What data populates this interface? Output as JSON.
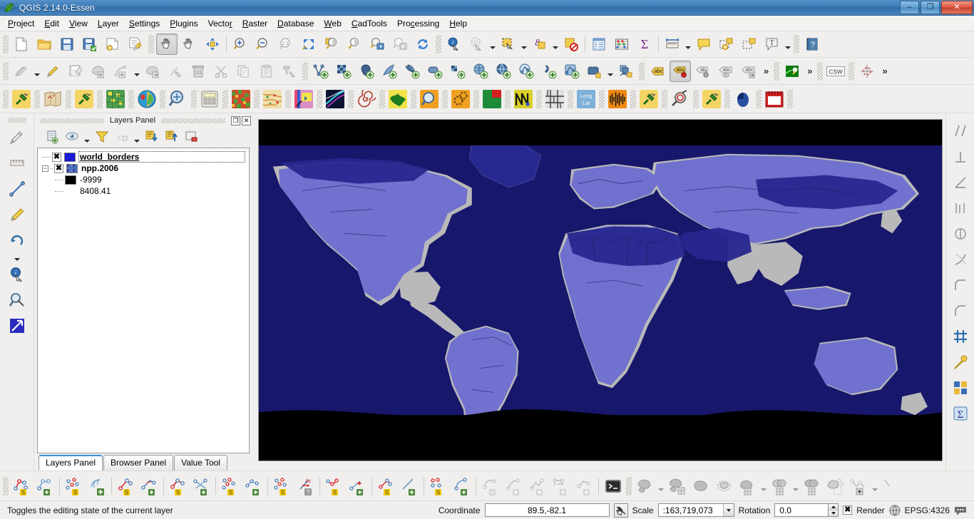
{
  "window": {
    "title": "QGIS 2.14.0-Essen",
    "app_icon": "qgis-logo-icon",
    "minimize_label": "–",
    "maximize_label": "❐",
    "close_label": "✕"
  },
  "menubar": {
    "items": [
      {
        "label": "Project",
        "accel": "P"
      },
      {
        "label": "Edit",
        "accel": "E"
      },
      {
        "label": "View",
        "accel": "V"
      },
      {
        "label": "Layer",
        "accel": "L"
      },
      {
        "label": "Settings",
        "accel": "S"
      },
      {
        "label": "Plugins",
        "accel": "P"
      },
      {
        "label": "Vector",
        "accel": "r"
      },
      {
        "label": "Raster",
        "accel": "R"
      },
      {
        "label": "Database",
        "accel": "D"
      },
      {
        "label": "Web",
        "accel": "W"
      },
      {
        "label": "CadTools",
        "accel": "C"
      },
      {
        "label": "Processing",
        "accel": "c"
      },
      {
        "label": "Help",
        "accel": "H"
      }
    ]
  },
  "toolbar_row1": {
    "icons": [
      "new-project-icon",
      "open-project-icon",
      "save-project-icon",
      "save-project-as-icon",
      "new-print-composer-icon",
      "composer-manager-icon",
      "pan-map-icon",
      "pan-to-selection-icon",
      "zoom-full-extent-icon",
      "zoom-in-icon",
      "zoom-out-icon",
      "zoom-native-icon",
      "zoom-full-icon",
      "zoom-to-layer-icon",
      "zoom-to-selection-icon",
      "zoom-last-icon",
      "zoom-next-icon",
      "refresh-icon",
      "identify-features-icon",
      "run-feature-action-icon",
      "select-features-icon",
      "select-by-expression-icon",
      "deselect-features-icon",
      "open-attribute-table-icon",
      "field-calculator-icon",
      "statistical-summary-icon",
      "measure-line-icon",
      "map-tips-icon",
      "new-map-note-icon",
      "annotation-icon",
      "text-annotation-icon",
      "help-icon"
    ],
    "active_tool": "pan-map-icon"
  },
  "toolbar_row2": {
    "icons": [
      "current-edits-icon",
      "toggle-editing-icon",
      "save-layer-edits-icon",
      "add-feature-icon",
      "add-node-icon",
      "move-feature-icon",
      "node-tool-icon",
      "delete-selected-icon",
      "cut-features-icon",
      "copy-features-icon",
      "paste-features-icon",
      "advanced-digitizing-icon",
      "add-vector-layer-icon",
      "add-raster-layer-icon",
      "add-postgis-layer-icon",
      "add-spatialite-layer-icon",
      "add-mssql-layer-icon",
      "add-oracle-layer-icon",
      "add-db2-layer-icon",
      "add-wms-layer-icon",
      "add-wcs-layer-icon",
      "add-wfs-layer-icon",
      "add-delimited-text-layer-icon",
      "new-shapefile-icon",
      "gps-tools-icon",
      "offline-editing-icon",
      "label-icon",
      "pin-labels-icon",
      "show-hide-labels-icon",
      "move-label-icon",
      "rotate-label-icon",
      "change-label-icon",
      "gps-information-icon",
      "csw-icon",
      "georeferencer-icon"
    ],
    "overflow_label": "»",
    "csw_label": "CSW"
  },
  "toolbar_row3": {
    "icons": [
      "plugin-green-plug-icon",
      "old-map-icon",
      "plugin-green-plug-2-icon",
      "green-grid-raster-icon",
      "globe-raster-icon",
      "zoom-magnifier-plugin-icon",
      "calculator-plugin-icon",
      "landcover-raster-icon",
      "terrain-raster-icon",
      "profile-plugin-icon",
      "pencil-draw-icon",
      "light-trails-icon",
      "spiral-icon",
      "green-map-icon",
      "search-magnifier-orange-icon",
      "gears-orange-icon",
      "green-red-square-icon",
      "wave-curve-icon",
      "mosaic-grid-icon",
      "long-lat-icon",
      "orange-waveform-icon",
      "plugin-green-plug-3-icon",
      "value-tool-icon",
      "plugin-green-plug-4-icon",
      "blue-mouse-icon",
      "red-calendar-icon"
    ]
  },
  "left_toolbar": {
    "icons": [
      "cad-tools-icon",
      "measure-tool-icon",
      "cad-construct-icon",
      "cad-pen-icon",
      "cad-rotate-icon",
      "cad-info-icon",
      "cad-inspect-icon",
      "cad-arrow-icon"
    ]
  },
  "right_toolbar": {
    "icons": [
      "parallel-line-icon",
      "perpendicular-icon",
      "angle-icon",
      "offset-icon",
      "extend-line-icon",
      "trim-icon",
      "fillet-icon",
      "chamfer-icon",
      "grid-snap-icon",
      "color-picker-icon",
      "layer-stack-icon",
      "sum-sigma-icon"
    ]
  },
  "layers_panel": {
    "title": "Layers Panel",
    "undock_label": "❐",
    "close_label": "✕",
    "tools": [
      "add-group-icon",
      "manage-visibility-icon",
      "filter-legend-icon",
      "expression-filter-icon",
      "expand-all-icon",
      "collapse-all-icon",
      "remove-layer-icon"
    ],
    "layers": [
      {
        "name": "world_borders",
        "checked": "✖",
        "swatch_color": "#1818d8",
        "selected": true,
        "expandable": false
      },
      {
        "name": "npp.2006",
        "checked": "✖",
        "swatch_color": "#4a6fc0",
        "selected": false,
        "expandable": true,
        "children": [
          {
            "label": "-9999",
            "swatch_color": "#000000"
          },
          {
            "label": "8408.41",
            "swatch_color": "#ffffff"
          }
        ]
      }
    ],
    "tabs": [
      {
        "label": "Layers Panel",
        "active": true
      },
      {
        "label": "Browser Panel",
        "active": false
      },
      {
        "label": "Value Tool",
        "active": false
      }
    ]
  },
  "map_canvas": {
    "name": "map-canvas",
    "background_color": "#000000",
    "ocean_color": "#1a1a6e",
    "land_color": "#b8b8b8",
    "vegetation_color": "#6b6bd4"
  },
  "bottom_toolbar": {
    "icons": [
      "graph-select-s-icon",
      "graph-add-icon",
      "points-select-s-icon",
      "curve-add-icon",
      "line-select-s-icon",
      "angle-add-icon",
      "tree-select-s-icon",
      "cross-add-icon",
      "scatter-select-s-icon",
      "chain-add-icon",
      "random-select-s-icon",
      "azimuth-help-icon",
      "edge-select-s-icon",
      "direction-add-icon",
      "arc-select-s-icon",
      "diagonal-add-icon",
      "node-select-s-icon",
      "spline-add-icon",
      "mean-curve-icon",
      "curve-plus-icon",
      "polyline-plus-icon",
      "network-plus-icon",
      "path-plus-icon",
      "console-icon",
      "geoproc-dissolve-icon",
      "geoproc-buffer-icon",
      "geoproc-convexhull-icon",
      "geoproc-clip-icon",
      "geoproc-difference-icon",
      "geoproc-intersect-icon",
      "geoproc-union-icon",
      "geoproc-symdiff-icon",
      "geometry-tools-icon",
      "analysis-icon"
    ]
  },
  "statusbar": {
    "message": "Toggles the editing state of the current layer",
    "coordinate_label": "Coordinate",
    "coordinate_value": "89.5,-82.1",
    "toggle_extents_icon": "toggle-extents-icon",
    "scale_label": "Scale",
    "scale_value": ":163,719,073",
    "rotation_label": "Rotation",
    "rotation_value": "0.0",
    "render_label": "Render",
    "render_checked": "✖",
    "crs_label": "EPSG:4326",
    "crs_icon": "crs-globe-icon",
    "messages_icon": "messages-bubble-icon"
  }
}
